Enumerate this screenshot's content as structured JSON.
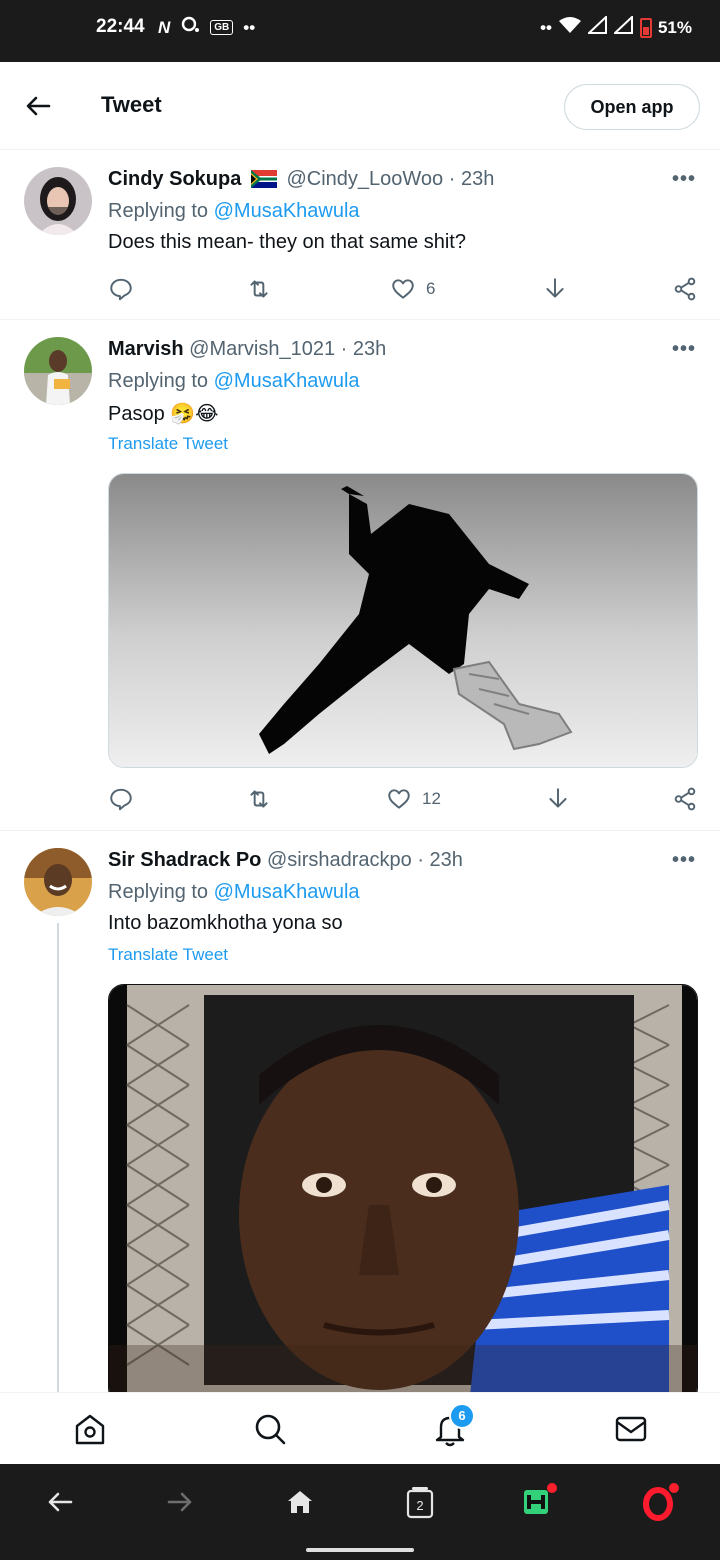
{
  "status_bar": {
    "time": "22:44",
    "notif_n": "N",
    "notif_gb": "GB",
    "dots_left": "••",
    "dots_right": "••",
    "battery": "51%"
  },
  "header": {
    "title": "Tweet",
    "open_app_label": "Open app"
  },
  "tweets": [
    {
      "name": "Cindy Sokupa",
      "handle": "@Cindy_LooWoo",
      "time": "· 23h",
      "replying_prefix": "Replying to",
      "replying_to": "@MusaKhawula",
      "text": "Does this mean- they on that same shit?",
      "likes": "6"
    },
    {
      "name": "Marvish",
      "handle": "@Marvish_1021",
      "time": "· 23h",
      "replying_prefix": "Replying to",
      "replying_to": "@MusaKhawula",
      "text": "Pasop 🤧😂",
      "translate": "Translate Tweet",
      "likes": "12"
    },
    {
      "name": "Sir Shadrack Po",
      "handle": "@sirshadrackpo",
      "time": "· 23h",
      "replying_prefix": "Replying to",
      "replying_to": "@MusaKhawula",
      "text": "Into bazomkhotha yona so",
      "translate": "Translate Tweet"
    }
  ],
  "more_label": "•••",
  "bottom_nav": {
    "notifications_badge": "6"
  },
  "browser_bar": {
    "tabs_count": "2"
  },
  "colors": {
    "accent": "#1d9bf0",
    "text_secondary": "#536471",
    "status_bg": "#1b1b1b"
  }
}
